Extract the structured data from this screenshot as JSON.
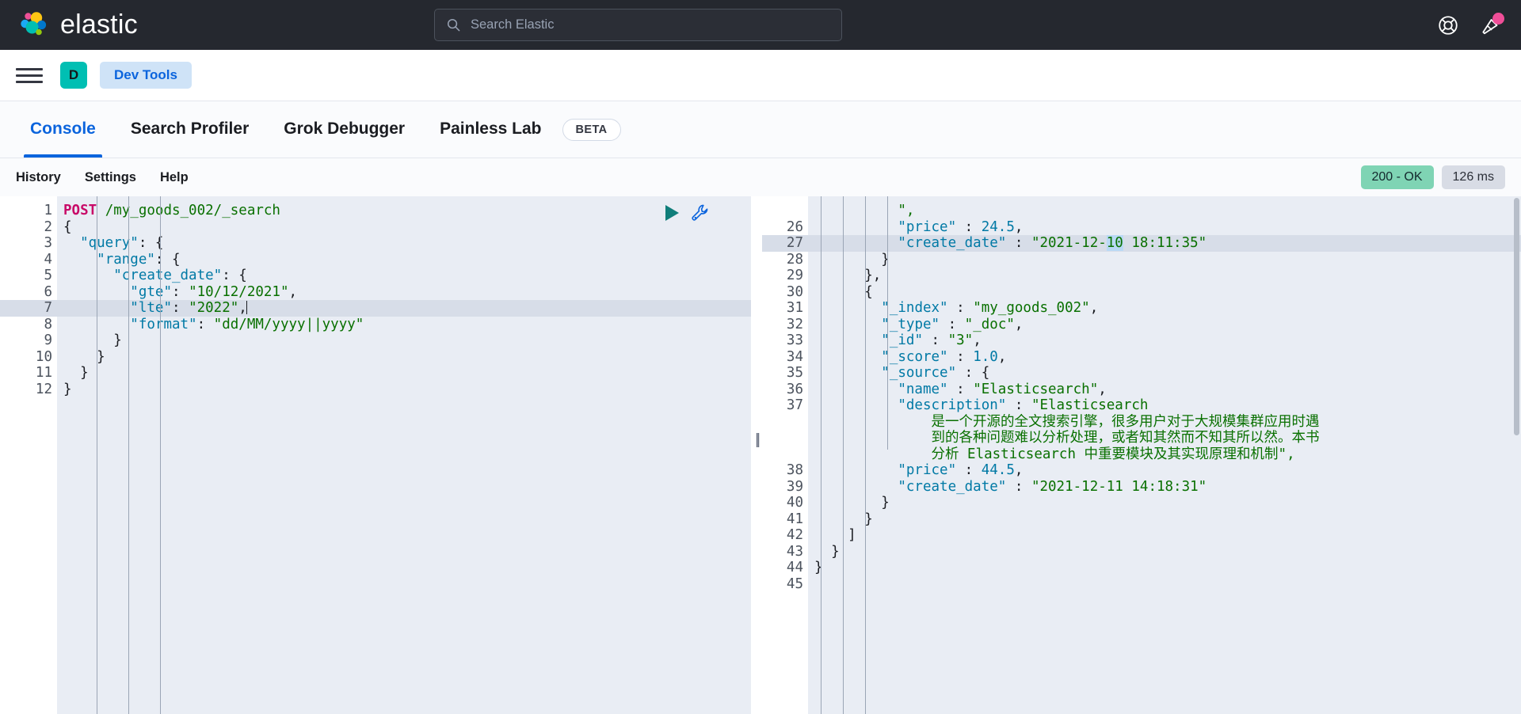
{
  "header": {
    "brand": "elastic",
    "logo_icon": "elastic-logo-icon",
    "search_placeholder": "Search Elastic",
    "search_icon": "search-icon",
    "help_icon": "lifebuoy-help-icon",
    "whatsnew_icon": "announcement-cone-icon"
  },
  "nav": {
    "menu_icon": "hamburger-menu-icon",
    "space_initial": "D",
    "breadcrumb": "Dev Tools"
  },
  "tabs": [
    {
      "label": "Console",
      "active": true
    },
    {
      "label": "Search Profiler",
      "active": false
    },
    {
      "label": "Grok Debugger",
      "active": false
    },
    {
      "label": "Painless Lab",
      "active": false
    }
  ],
  "beta_badge": "BETA",
  "console_toolbar": {
    "history": "History",
    "settings": "Settings",
    "help": "Help",
    "status_code": "200 - OK",
    "duration": "126 ms"
  },
  "editor_actions": {
    "run_icon": "play-run-icon",
    "wrench_icon": "wrench-settings-icon"
  },
  "request": {
    "first_line_number": 1,
    "lines": [
      {
        "n": "1",
        "fold": "",
        "tokens": [
          {
            "t": "POST",
            "c": "m"
          },
          {
            "t": " ",
            "c": "p"
          },
          {
            "t": "/my_goods_002/_search",
            "c": "u"
          }
        ]
      },
      {
        "n": "2",
        "fold": "▾",
        "tokens": [
          {
            "t": "{",
            "c": "p"
          }
        ]
      },
      {
        "n": "3",
        "fold": "▾",
        "tokens": [
          {
            "t": "  ",
            "c": "p"
          },
          {
            "t": "\"query\"",
            "c": "k"
          },
          {
            "t": ": {",
            "c": "p"
          }
        ]
      },
      {
        "n": "4",
        "fold": "▾",
        "tokens": [
          {
            "t": "    ",
            "c": "p"
          },
          {
            "t": "\"range\"",
            "c": "k"
          },
          {
            "t": ": {",
            "c": "p"
          }
        ]
      },
      {
        "n": "5",
        "fold": "▾",
        "tokens": [
          {
            "t": "      ",
            "c": "p"
          },
          {
            "t": "\"create_date\"",
            "c": "k"
          },
          {
            "t": ": {",
            "c": "p"
          }
        ]
      },
      {
        "n": "6",
        "fold": "",
        "tokens": [
          {
            "t": "        ",
            "c": "p"
          },
          {
            "t": "\"gte\"",
            "c": "k"
          },
          {
            "t": ": ",
            "c": "p"
          },
          {
            "t": "\"10/12/2021\"",
            "c": "s"
          },
          {
            "t": ",",
            "c": "p"
          }
        ]
      },
      {
        "n": "7",
        "fold": "",
        "hl": true,
        "caret": true,
        "tokens": [
          {
            "t": "        ",
            "c": "p"
          },
          {
            "t": "\"lte\"",
            "c": "k"
          },
          {
            "t": ": ",
            "c": "p"
          },
          {
            "t": "\"2022\"",
            "c": "s"
          },
          {
            "t": ",",
            "c": "p"
          }
        ]
      },
      {
        "n": "8",
        "fold": "",
        "tokens": [
          {
            "t": "        ",
            "c": "p"
          },
          {
            "t": "\"format\"",
            "c": "k"
          },
          {
            "t": ": ",
            "c": "p"
          },
          {
            "t": "\"dd/MM/yyyy||yyyy\"",
            "c": "s"
          }
        ]
      },
      {
        "n": "9",
        "fold": "▴",
        "tokens": [
          {
            "t": "      }",
            "c": "p"
          }
        ]
      },
      {
        "n": "10",
        "fold": "▴",
        "tokens": [
          {
            "t": "    }",
            "c": "p"
          }
        ]
      },
      {
        "n": "11",
        "fold": "▴",
        "tokens": [
          {
            "t": "  }",
            "c": "p"
          }
        ]
      },
      {
        "n": "12",
        "fold": "▴",
        "tokens": [
          {
            "t": "}",
            "c": "p"
          }
        ]
      }
    ]
  },
  "response": {
    "lines": [
      {
        "n": "",
        "fold": "",
        "tokens": [
          {
            "t": "          ",
            "c": "p"
          },
          {
            "t": "\",",
            "c": "s"
          }
        ]
      },
      {
        "n": "26",
        "fold": "",
        "tokens": [
          {
            "t": "          ",
            "c": "p"
          },
          {
            "t": "\"price\"",
            "c": "k"
          },
          {
            "t": " : ",
            "c": "p"
          },
          {
            "t": "24.5",
            "c": "n"
          },
          {
            "t": ",",
            "c": "p"
          }
        ]
      },
      {
        "n": "27",
        "fold": "",
        "hl": true,
        "tokens": [
          {
            "t": "          ",
            "c": "p"
          },
          {
            "t": "\"create_date\"",
            "c": "k"
          },
          {
            "t": " : ",
            "c": "p"
          },
          {
            "t": "\"2021-12-",
            "c": "s"
          },
          {
            "t": "10",
            "c": "s sel"
          },
          {
            "t": " 18:11:35\"",
            "c": "s"
          }
        ]
      },
      {
        "n": "28",
        "fold": "▴",
        "tokens": [
          {
            "t": "        }",
            "c": "p"
          }
        ]
      },
      {
        "n": "29",
        "fold": "▴",
        "tokens": [
          {
            "t": "      },",
            "c": "p"
          }
        ]
      },
      {
        "n": "30",
        "fold": "▾",
        "tokens": [
          {
            "t": "      {",
            "c": "p"
          }
        ]
      },
      {
        "n": "31",
        "fold": "",
        "tokens": [
          {
            "t": "        ",
            "c": "p"
          },
          {
            "t": "\"_index\"",
            "c": "k"
          },
          {
            "t": " : ",
            "c": "p"
          },
          {
            "t": "\"my_goods_002\"",
            "c": "s"
          },
          {
            "t": ",",
            "c": "p"
          }
        ]
      },
      {
        "n": "32",
        "fold": "",
        "tokens": [
          {
            "t": "        ",
            "c": "p"
          },
          {
            "t": "\"_type\"",
            "c": "k"
          },
          {
            "t": " : ",
            "c": "p"
          },
          {
            "t": "\"_doc\"",
            "c": "s"
          },
          {
            "t": ",",
            "c": "p"
          }
        ]
      },
      {
        "n": "33",
        "fold": "",
        "tokens": [
          {
            "t": "        ",
            "c": "p"
          },
          {
            "t": "\"_id\"",
            "c": "k"
          },
          {
            "t": " : ",
            "c": "p"
          },
          {
            "t": "\"3\"",
            "c": "s"
          },
          {
            "t": ",",
            "c": "p"
          }
        ]
      },
      {
        "n": "34",
        "fold": "",
        "tokens": [
          {
            "t": "        ",
            "c": "p"
          },
          {
            "t": "\"_score\"",
            "c": "k"
          },
          {
            "t": " : ",
            "c": "p"
          },
          {
            "t": "1.0",
            "c": "n"
          },
          {
            "t": ",",
            "c": "p"
          }
        ]
      },
      {
        "n": "35",
        "fold": "▾",
        "tokens": [
          {
            "t": "        ",
            "c": "p"
          },
          {
            "t": "\"_source\"",
            "c": "k"
          },
          {
            "t": " : {",
            "c": "p"
          }
        ]
      },
      {
        "n": "36",
        "fold": "",
        "tokens": [
          {
            "t": "          ",
            "c": "p"
          },
          {
            "t": "\"name\"",
            "c": "k"
          },
          {
            "t": " : ",
            "c": "p"
          },
          {
            "t": "\"Elasticsearch\"",
            "c": "s"
          },
          {
            "t": ",",
            "c": "p"
          }
        ]
      },
      {
        "n": "37",
        "fold": "",
        "tokens": [
          {
            "t": "          ",
            "c": "p"
          },
          {
            "t": "\"description\"",
            "c": "k"
          },
          {
            "t": " : ",
            "c": "p"
          },
          {
            "t": "\"Elasticsearch",
            "c": "s"
          }
        ]
      },
      {
        "n": "",
        "fold": "",
        "wrap": true,
        "tokens": [
          {
            "t": "              是一个开源的全文搜索引擎，很多用户对于大规模集群应用时遇",
            "c": "s"
          }
        ]
      },
      {
        "n": "",
        "fold": "",
        "wrap": true,
        "tokens": [
          {
            "t": "              到的各种问题难以分析处理，或者知其然而不知其所以然。本书",
            "c": "s"
          }
        ]
      },
      {
        "n": "",
        "fold": "",
        "wrap": true,
        "tokens": [
          {
            "t": "              分析 Elasticsearch 中重要模块及其实现原理和机制\",",
            "c": "s"
          }
        ]
      },
      {
        "n": "38",
        "fold": "",
        "tokens": [
          {
            "t": "          ",
            "c": "p"
          },
          {
            "t": "\"price\"",
            "c": "k"
          },
          {
            "t": " : ",
            "c": "p"
          },
          {
            "t": "44.5",
            "c": "n"
          },
          {
            "t": ",",
            "c": "p"
          }
        ]
      },
      {
        "n": "39",
        "fold": "",
        "tokens": [
          {
            "t": "          ",
            "c": "p"
          },
          {
            "t": "\"create_date\"",
            "c": "k"
          },
          {
            "t": " : ",
            "c": "p"
          },
          {
            "t": "\"2021-12-11 14:18:31\"",
            "c": "s"
          }
        ]
      },
      {
        "n": "40",
        "fold": "▴",
        "tokens": [
          {
            "t": "        }",
            "c": "p"
          }
        ]
      },
      {
        "n": "41",
        "fold": "▴",
        "tokens": [
          {
            "t": "      }",
            "c": "p"
          }
        ]
      },
      {
        "n": "42",
        "fold": "▴",
        "tokens": [
          {
            "t": "    ]",
            "c": "p"
          }
        ]
      },
      {
        "n": "43",
        "fold": "▴",
        "tokens": [
          {
            "t": "  }",
            "c": "p"
          }
        ]
      },
      {
        "n": "44",
        "fold": "▴",
        "tokens": [
          {
            "t": "}",
            "c": "p"
          }
        ]
      },
      {
        "n": "45",
        "fold": "",
        "tokens": [
          {
            "t": "",
            "c": "p"
          }
        ]
      }
    ]
  },
  "colors": {
    "header_bg": "#25282f",
    "accent_blue": "#0b64dd",
    "teal": "#00bfb3",
    "status_ok_bg": "#7fd4b4",
    "notification_pink": "#f04e98",
    "editor_bg": "#e9edf4",
    "highlight_line": "#d7dde8",
    "selection": "#b9d9f5",
    "string_green": "#097000",
    "key_blue": "#0079a5",
    "method_crimson": "#c80a68"
  }
}
